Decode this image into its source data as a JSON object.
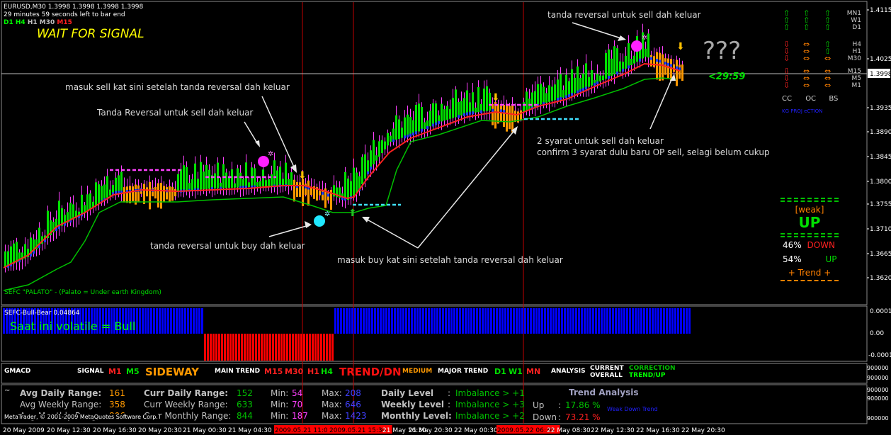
{
  "header": {
    "symbol_line": "EURUSD,M30  1.3998 1.3998 1.3998 1.3998",
    "timer_line": "29 minutes 59 seconds left to bar end",
    "tf_d1": "D1",
    "tf_h4": "H4",
    "tf_h1": "H1",
    "tf_m30": "M30",
    "tf_m15": "M15",
    "wait_signal": "WAIT FOR SIGNAL",
    "indicator_label": "SEFC \"PALATO\" - (Palato = Under earth Kingdom)"
  },
  "annotations": {
    "sell_reversal_top": "tanda reversal untuk sell dah keluar",
    "masuk_sell": "masuk sell kat sini setelah tanda reversal dah keluar",
    "tanda_reversal_sell": "Tanda Reversal untuk sell dah keluar",
    "buy_reversal": "tanda reversal untuk buy dah keluar",
    "masuk_buy": "masuk buy kat sini setelah tanda reversal dah keluar",
    "dua_syarat": "2 syarat untuk sell dah keluar",
    "confirm": "confirm 3 syarat dulu baru OP sell, selagi belum cukup",
    "question": "???",
    "countdown": "<29:59"
  },
  "price_axis": {
    "labels": [
      "1.4115",
      "1.4025",
      "1.3998",
      "1.3935",
      "1.3890",
      "1.3845",
      "1.3800",
      "1.3755",
      "1.3710",
      "1.3665",
      "1.3620"
    ],
    "current": "1.3998"
  },
  "mtf_panel": {
    "tf_labels": [
      "MN1",
      "W1",
      "D1",
      "H4",
      "H1",
      "M30",
      "M15",
      "M5",
      "M1"
    ],
    "col_labels": [
      "CC",
      "OC",
      "BS"
    ],
    "caption": "KG PROJ eCTION",
    "colors": {
      "up": "#00d000",
      "down": "#ff2020",
      "neutral": "#ff8000"
    }
  },
  "trend_box": {
    "weak": "[weak]",
    "direction": "UP",
    "down_pct": "46%",
    "down_label": "DOWN",
    "up_pct": "54%",
    "up_label": "UP",
    "trend": "+   Trend   +"
  },
  "bullbear": {
    "title": "SEFC-Bull-Bear 0.04864",
    "status": "Saat ini volatile = Bull",
    "axis": [
      "0.0001",
      "0.00",
      "-0.0001"
    ],
    "colors": {
      "bull": "#0000ff",
      "bear": "#ff0000"
    }
  },
  "gmacd": {
    "title": "GMACD",
    "signal": "SIGNAL",
    "sig_m1": "M1",
    "sig_m5": "M5",
    "sideway": "SIDEWAY",
    "main_trend": "MAIN TREND",
    "mt_m15": "M15",
    "mt_m30": "M30",
    "mt_h1": "H1",
    "mt_h4": "H4",
    "trend_dn": "TREND/DN",
    "medium": "MEDIUM",
    "major_trend": "MAJOR TREND",
    "mj_d1": "D1",
    "mj_w1": "W1",
    "mj_mn": "MN",
    "analysis": "ANALYSIS",
    "current": "CURRENT",
    "overall": "OVERALL",
    "correction": "CORRECTION",
    "trend_up": "TREND/UP",
    "axis": [
      "900000",
      "900000"
    ]
  },
  "range_panel": {
    "avg_daily_label": "Avg Daily Range:",
    "avg_daily": "161",
    "avg_weekly_label": "Avg Weekly Range:",
    "avg_weekly": "358",
    "avg_monthly_label": "Avg Monthly Range:",
    "avg_monthly": "806",
    "curr_daily_label": "Curr Daily Range:",
    "curr_daily": "152",
    "curr_weekly_label": "Curr Weekly Range:",
    "curr_weekly": "633",
    "curr_monthly_label": "Curr Monthly Range:",
    "curr_monthly": "844",
    "min_label": "Min:",
    "min_d": "54",
    "min_w": "70",
    "min_m": "187",
    "max_label": "Max:",
    "max_d": "208",
    "max_w": "646",
    "max_m": "1423",
    "daily_level": "Daily Level",
    "weekly_level": "Weekly Level",
    "monthly_level": "Monthly Level:",
    "colon": ":",
    "imb_d": "Imbalance > +1",
    "imb_w": "Imbalance > +3",
    "imb_m": "Imbalance > +2",
    "trend_analysis": "Trend Analysis",
    "up_label": "Up",
    "up_value": "17.86 %",
    "down_label": "Down",
    "down_value": "73.21 %",
    "weak_down": "Weak Down Trend",
    "copyright": "MetaTrader, © 2001-2009 MetaQuotes Software Corp.",
    "tilde": "~",
    "axis": [
      "900000",
      "900000",
      "900000"
    ]
  },
  "time_axis": {
    "labels": [
      "20 May 2009",
      "20 May 12:30",
      "20 May 16:30",
      "20 May 20:30",
      "21 May 00:30",
      "21 May 04:30",
      "2009.05.21 11:0",
      "2009.05.21 15:30",
      "21 May 16:30",
      "21 May 20:30",
      "22 May 00:30",
      "2009.05.22 06:30",
      "22 May 08:30",
      "22 May 12:30",
      "22 May 16:30",
      "22 May 20:30"
    ],
    "highlighted": [
      "2009.05.21 11:0",
      "2009.05.21 15:30",
      "2009.05.22 06:30"
    ]
  }
}
